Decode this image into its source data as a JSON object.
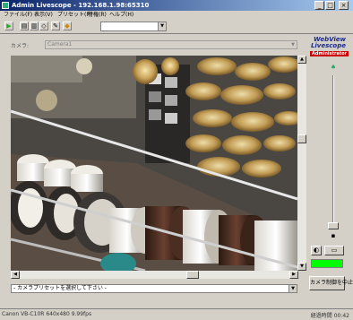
{
  "window": {
    "title": "Admin Livescope - 192.168.1.98:65310",
    "minimize": "_",
    "maximize": "□",
    "close": "×"
  },
  "menu": [
    "ファイル(F)",
    "表示(V)",
    "プリセット(P)",
    "特権(R)",
    "ヘルプ(H)"
  ],
  "toolbar": {
    "buttons": [
      "play-icon",
      "layout-1-icon",
      "layout-2-icon",
      "preset-icon",
      "settings-icon",
      "snapshot-icon"
    ],
    "dropdown_value": ""
  },
  "camera": {
    "label": "カメラ:",
    "value": "Camera1"
  },
  "logo": {
    "line1": "WebView",
    "line2": "Livescope",
    "line3": "Administrator"
  },
  "preset": {
    "placeholder": "- カメラプリセットを選択して下さい -"
  },
  "controls": {
    "release_button": "カメラ制御を中止",
    "status_color": "#00ff00"
  },
  "status": {
    "left": "Canon VB-C10R  640x480  9.99fps",
    "right": "経過時間 00:42"
  }
}
